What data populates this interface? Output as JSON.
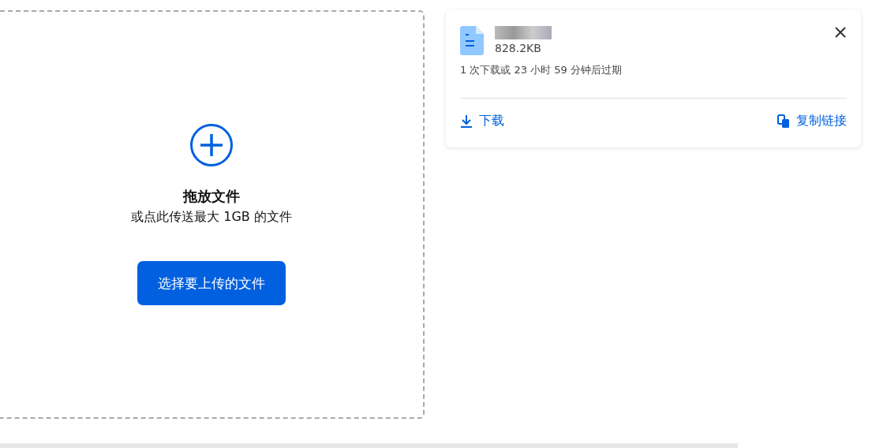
{
  "dropzone": {
    "title": "拖放文件",
    "subtitle": "或点此传送最大 1GB 的文件",
    "button": "选择要上传的文件"
  },
  "file_card": {
    "size": "828.2KB",
    "expiry": "1 次下载或 23 小时 59 分钟后过期",
    "actions": [
      {
        "kind": "download",
        "label": "下载"
      },
      {
        "kind": "copy",
        "label": "复制链接"
      }
    ]
  }
}
